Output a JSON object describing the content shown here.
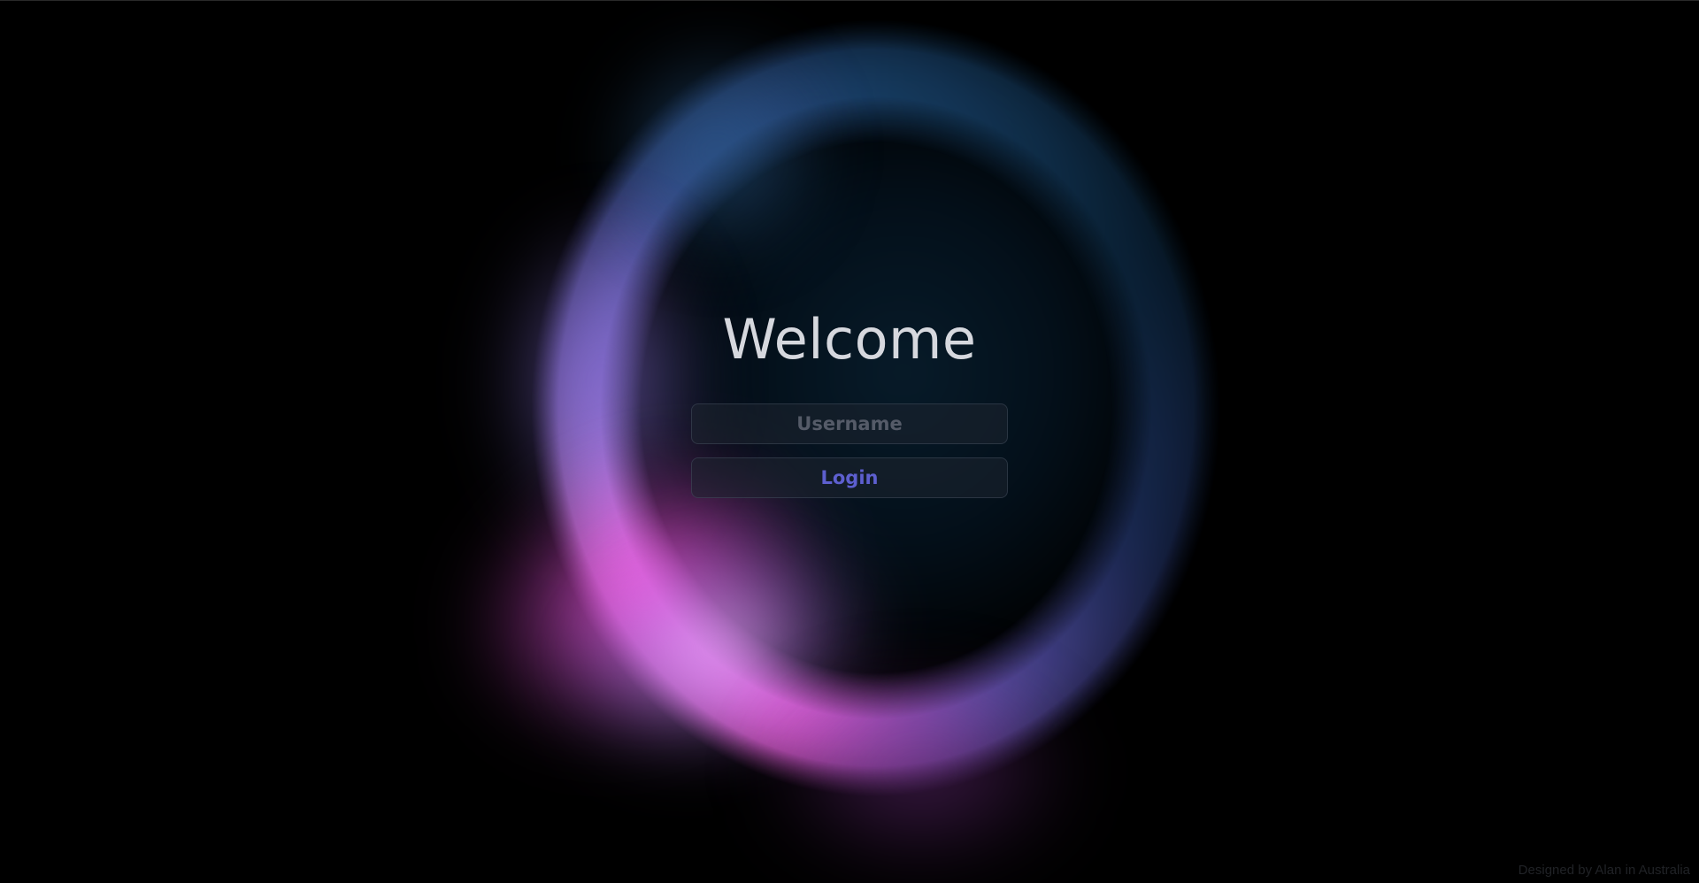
{
  "login": {
    "title": "Welcome",
    "username_placeholder": "Username",
    "username_value": "",
    "login_label": "Login"
  },
  "footer": {
    "credit": "Designed by Alan in Australia"
  },
  "theme": {
    "background": "#000000",
    "title_color": "#d6d8de",
    "button_text_color": "#5d5fcf",
    "placeholder_color": "#555b68",
    "glow_colors": [
      "#ff5ee0",
      "#e88ef4",
      "#8f6fd6",
      "#173f66"
    ]
  }
}
